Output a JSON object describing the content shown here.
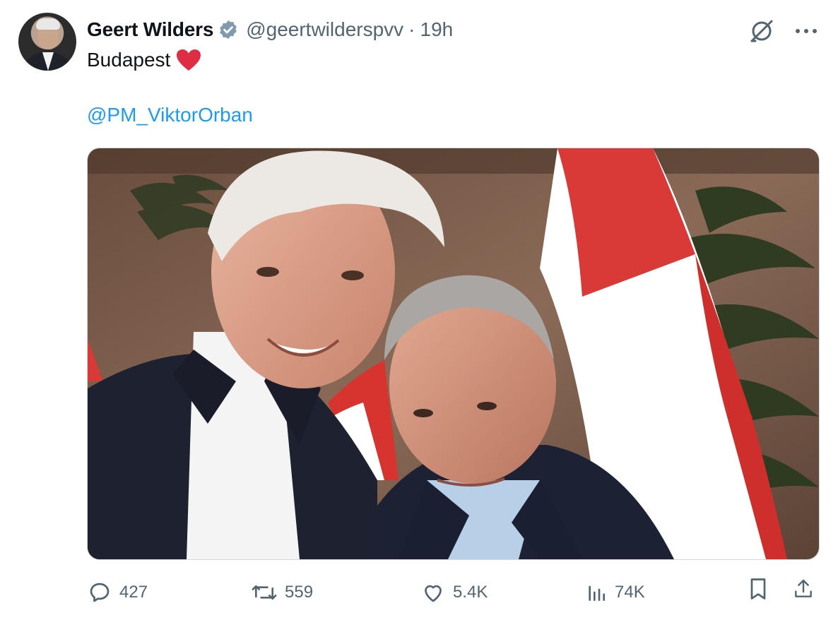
{
  "tweet": {
    "author_name": "Geert Wilders",
    "handle": "@geertwilderspvv",
    "separator": "·",
    "time": "19h",
    "text": "Budapest",
    "mention": "@PM_ViktorOrban"
  },
  "icons": {
    "verified": "verified-badge-icon",
    "grok": "grok-icon",
    "more": "more-icon",
    "heart_emoji": "red-heart-emoji"
  },
  "actions": {
    "replies": "427",
    "reposts": "559",
    "likes": "5.4K",
    "views": "74K"
  },
  "colors": {
    "accent": "#1d9bf0",
    "secondary_text": "#536471",
    "heart": "#e0245e"
  }
}
